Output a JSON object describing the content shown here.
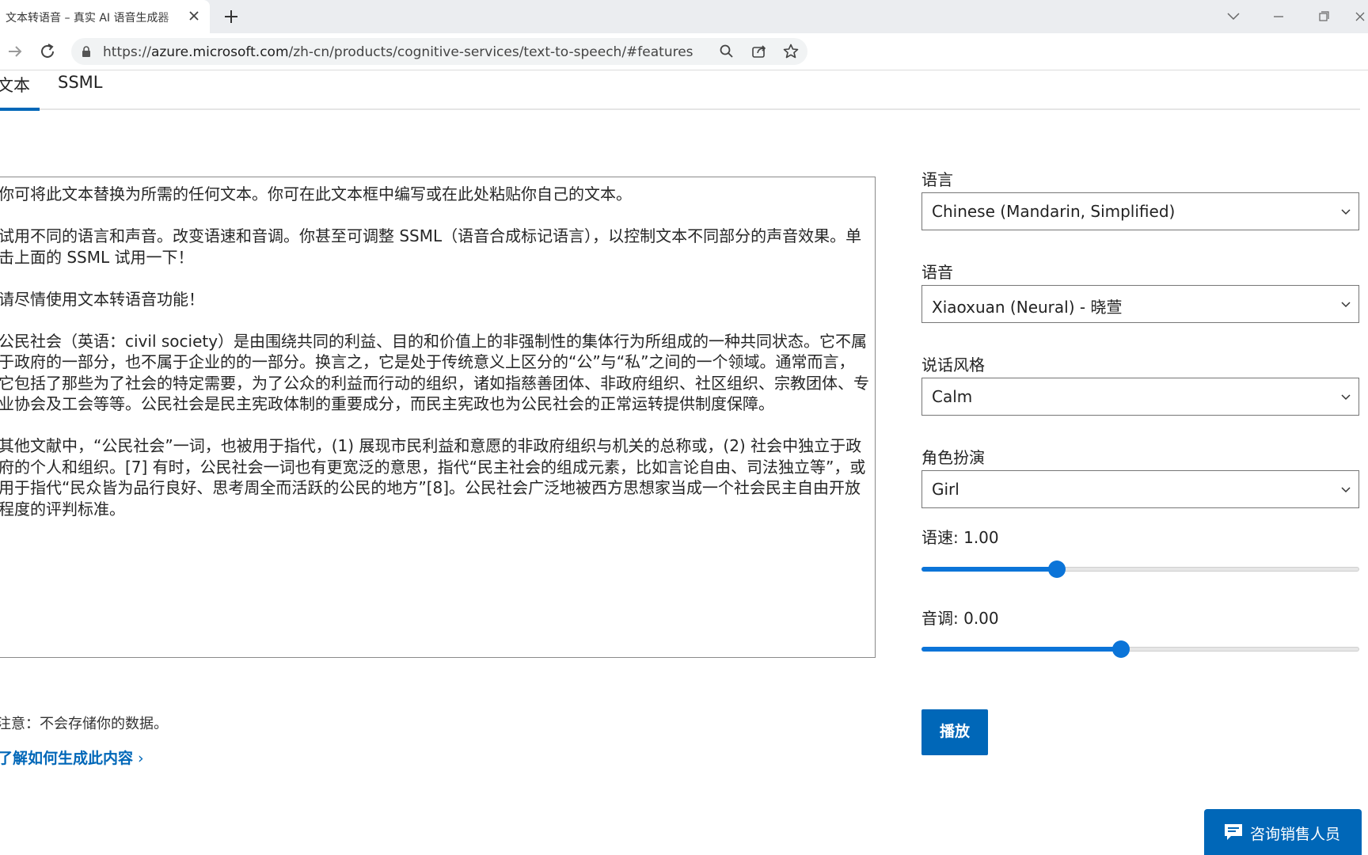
{
  "browser": {
    "tab_title": "文本转语音 – 真实 AI 语音生成器",
    "url_prefix": "https://",
    "url_host": "azure.microsoft.com",
    "url_path": "/zh-cn/products/cognitive-services/text-to-speech/#features"
  },
  "page_tabs": {
    "text": "文本",
    "ssml": "SSML"
  },
  "editor": {
    "paragraphs": [
      "你可将此文本替换为所需的任何文本。你可在此文本框中编写或在此处粘贴你自己的文本。",
      "试用不同的语言和声音。改变语速和音调。你甚至可调整 SSML（语音合成标记语言），以控制文本不同部分的声音效果。单击上面的 SSML 试用一下！",
      "请尽情使用文本转语音功能！",
      "公民社会（英语：civil society）是由围绕共同的利益、目的和价值上的非强制性的集体行为所组成的一种共同状态。它不属于政府的一部分，也不属于企业的的一部分。换言之，它是处于传统意义上区分的“公”与“私”之间的一个领域。通常而言，它包括了那些为了社会的特定需要，为了公众的利益而行动的组织，诸如指慈善团体、非政府组织、社区组织、宗教团体、专业协会及工会等等。公民社会是民主宪政体制的重要成分，而民主宪政也为公民社会的正常运转提供制度保障。",
      "其他文献中，“公民社会”一词，也被用于指代，(1) 展现市民利益和意愿的非政府组织与机关的总称或，(2) 社会中独立于政府的个人和组织。[7] 有时，公民社会一词也有更宽泛的意思，指代“民主社会的组成元素，比如言论自由、司法独立等”，或用于指代“民众皆为品行良好、思考周全而活跃的公民的地方”[8]。公民社会广泛地被西方思想家当成一个社会民主自由开放程度的评判标准。"
    ]
  },
  "note": "注意：不会存储你的数据。",
  "learn_link": "了解如何生成此内容",
  "controls": {
    "language_label": "语言",
    "language_value": "Chinese (Mandarin, Simplified)",
    "voice_label": "语音",
    "voice_value": "Xiaoxuan (Neural) - 晓萱",
    "style_label": "说话风格",
    "style_value": "Calm",
    "role_label": "角色扮演",
    "role_value": "Girl",
    "rate_label": "语速: 1.00",
    "rate_fraction": 0.31,
    "pitch_label": "音调: 0.00",
    "pitch_fraction": 0.455,
    "play_label": "播放"
  },
  "contact_sales": "咨询销售人员",
  "colors": {
    "accent": "#0067b8",
    "slider": "#0b74d8"
  }
}
